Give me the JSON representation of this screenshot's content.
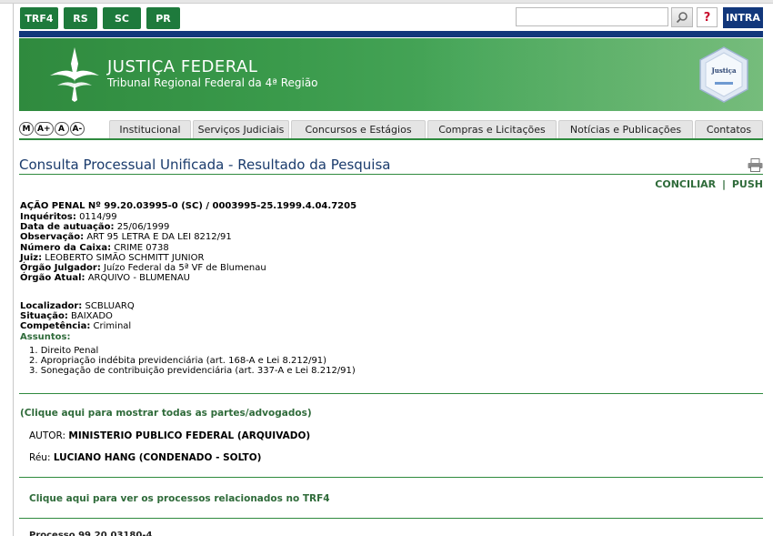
{
  "topbar": {
    "tabs": [
      "TRF4",
      "RS",
      "SC",
      "PR"
    ],
    "search_placeholder": "",
    "help_label": "?",
    "intra_label": "INTRA"
  },
  "banner": {
    "title": "JUSTIÇA FEDERAL",
    "subtitle": "Tribunal Regional Federal da 4ª Região",
    "seal_text": "Justiça"
  },
  "font_controls": [
    "M",
    "A+",
    "A",
    "A-"
  ],
  "menu": [
    "Institucional",
    "Serviços Judiciais",
    "Concursos e Estágios",
    "Compras e Licitações",
    "Notícias e Publicações",
    "Contatos"
  ],
  "page": {
    "title": "Consulta Processual Unificada - Resultado da Pesquisa",
    "conciliar": "CONCILIAR",
    "separator": "|",
    "push": "PUSH"
  },
  "process": {
    "header": "AÇÃO PENAL Nº 99.20.03995-0 (SC) / 0003995-25.1999.4.04.7205",
    "fields": [
      {
        "label": "Inquéritos:",
        "value": "0114/99"
      },
      {
        "label": "Data de autuação:",
        "value": "25/06/1999"
      },
      {
        "label": "Observação:",
        "value": "ART 95 LETRA E DA LEI 8212/91"
      },
      {
        "label": "Número da Caixa:",
        "value": "CRIME 0738"
      },
      {
        "label": "Juiz:",
        "value": "LEOBERTO SIMÃO SCHMITT JUNIOR"
      },
      {
        "label": "Órgão Julgador:",
        "value": "Juízo Federal da 5ª VF de Blumenau"
      },
      {
        "label": "Órgão Atual:",
        "value": "ARQUIVO - BLUMENAU"
      }
    ],
    "fields2": [
      {
        "label": "Localizador:",
        "value": "SCBLUARQ"
      },
      {
        "label": "Situação:",
        "value": "BAIXADO"
      },
      {
        "label": "Competência:",
        "value": "Criminal"
      }
    ],
    "assuntos_label": "Assuntos:",
    "assuntos": [
      "1. Direito Penal",
      "2. Apropriação indébita previdenciária (art. 168-A e Lei 8.212/91)",
      "3. Sonegação de contribuição previdenciária (art. 337-A e Lei 8.212/91)"
    ]
  },
  "parties": {
    "show_all_link": "(Clique aqui para mostrar todas as partes/advogados)",
    "autor_label": "AUTOR:",
    "autor_value": "MINISTERIO PUBLICO FEDERAL (ARQUIVADO)",
    "reu_label": "Réu:",
    "reu_value": "LUCIANO HANG (CONDENADO - SOLTO)"
  },
  "related_link": "Clique aqui para ver os processos relacionados no TRF4",
  "cut_text": "Processo 99.20.03180-4",
  "colors": {
    "green": "#2f8a3e",
    "navy": "#12377b",
    "title_blue": "#1a3b6c",
    "link_green": "#2f6b3a"
  }
}
